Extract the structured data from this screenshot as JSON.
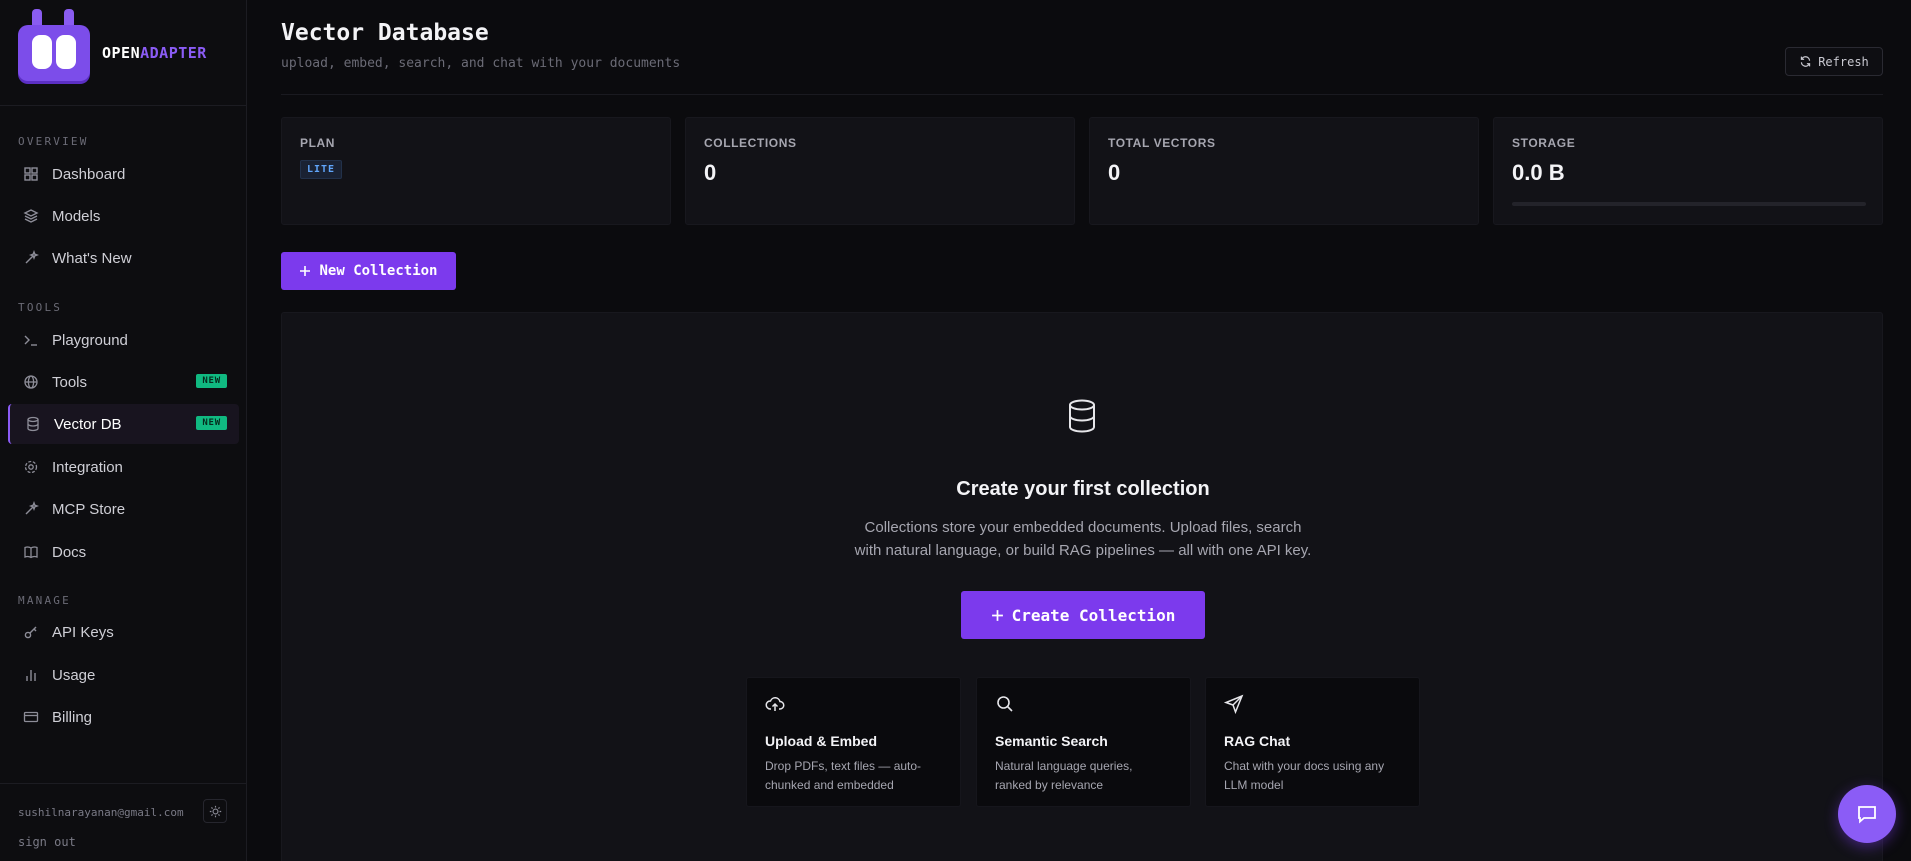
{
  "brand": {
    "part1": "OPEN",
    "part2": "ADAPTER"
  },
  "sidebar": {
    "sections": [
      {
        "label": "OVERVIEW"
      },
      {
        "label": "TOOLS"
      },
      {
        "label": "MANAGE"
      }
    ],
    "items": [
      {
        "label": "Dashboard",
        "icon": "grid-icon"
      },
      {
        "label": "Models",
        "icon": "layers-icon"
      },
      {
        "label": "What's New",
        "icon": "sparkle-icon"
      },
      {
        "label": "Playground",
        "icon": "terminal-icon"
      },
      {
        "label": "Tools",
        "icon": "globe-icon",
        "badge": "NEW"
      },
      {
        "label": "Vector DB",
        "icon": "database-icon",
        "badge": "NEW",
        "active": true
      },
      {
        "label": "Integration",
        "icon": "gear-icon"
      },
      {
        "label": "MCP Store",
        "icon": "sparkle-icon"
      },
      {
        "label": "Docs",
        "icon": "book-icon"
      },
      {
        "label": "API Keys",
        "icon": "key-icon"
      },
      {
        "label": "Usage",
        "icon": "bar-chart-icon"
      },
      {
        "label": "Billing",
        "icon": "credit-card-icon"
      }
    ],
    "footer": {
      "email": "sushilnarayanan@gmail.com",
      "signout": "sign out"
    }
  },
  "header": {
    "title": "Vector Database",
    "subtitle": "upload, embed, search, and chat with your documents",
    "refresh_label": "Refresh"
  },
  "stats": [
    {
      "label": "PLAN",
      "badge": "LITE"
    },
    {
      "label": "COLLECTIONS",
      "value": "0"
    },
    {
      "label": "TOTAL VECTORS",
      "value": "0"
    },
    {
      "label": "STORAGE",
      "value": "0.0 B",
      "usage_fraction": 0
    }
  ],
  "actions": {
    "new_collection": "New Collection"
  },
  "empty_state": {
    "title": "Create your first collection",
    "desc_line1": "Collections store your embedded documents. Upload files, search",
    "desc_line2": "with natural language, or build RAG pipelines — all with one API key.",
    "cta": "Create Collection",
    "features": [
      {
        "title": "Upload & Embed",
        "desc": "Drop PDFs, text files — auto-chunked and embedded",
        "icon": "cloud-upload-icon"
      },
      {
        "title": "Semantic Search",
        "desc": "Natural language queries, ranked by relevance",
        "icon": "search-icon"
      },
      {
        "title": "RAG Chat",
        "desc": "Chat with your docs using any LLM model",
        "icon": "send-icon"
      }
    ]
  },
  "colors": {
    "accent": "#7c3aed",
    "badge_new": "#10b981",
    "plan_badge": "#60a5fa"
  }
}
